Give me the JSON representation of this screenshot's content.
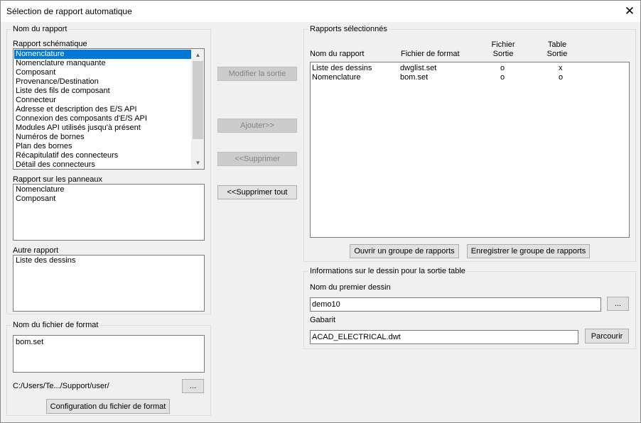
{
  "window": {
    "title": "Sélection de rapport automatique",
    "close_glyph": "✕"
  },
  "left": {
    "group_title": "Nom du rapport",
    "schematic": {
      "label": "Rapport schématique",
      "items": [
        "Nomenclature",
        "Nomenclature manquante",
        "Composant",
        "Provenance/Destination",
        "Liste des fils de composant",
        "Connecteur",
        "Adresse et description des E/S API",
        "Connexion des composants d'E/S API",
        "Modules API utilisés jusqu'à présent",
        "Numéros de bornes",
        "Plan des bornes",
        "Récapitulatif des connecteurs",
        "Détail des connecteurs"
      ],
      "selected": "Nomenclature",
      "scroll_up": "▲",
      "scroll_down": "▼"
    },
    "panel": {
      "label": "Rapport sur les panneaux",
      "items": [
        "Nomenclature",
        "Composant"
      ]
    },
    "other": {
      "label": "Autre rapport",
      "items": [
        "Liste des dessins"
      ]
    },
    "format_group": {
      "title": "Nom du fichier de format",
      "file": "bom.set",
      "path": "C:/Users/Te.../Support/user/",
      "browse_label": "...",
      "config_label": "Configuration du fichier de format"
    }
  },
  "middle": {
    "modify_label": "Modifier la sortie",
    "add_label": "Ajouter>>",
    "remove_label": "<<Supprimer",
    "remove_all_label": "<<Supprimer tout"
  },
  "right": {
    "group_title": "Rapports sélectionnés",
    "headers": {
      "name": "Nom du rapport",
      "format": "Fichier de format",
      "file_out_1": "Fichier",
      "file_out_2": "Sortie",
      "table_out_1": "Table",
      "table_out_2": "Sortie"
    },
    "rows": [
      {
        "name": "Liste des dessins",
        "format": "dwglist.set",
        "file": "o",
        "table": "x"
      },
      {
        "name": "Nomenclature",
        "format": "bom.set",
        "file": "o",
        "table": "o"
      }
    ],
    "open_group_label": "Ouvrir un groupe de rapports",
    "save_group_label": "Enregistrer le groupe de rapports",
    "drawing_info": {
      "title": "Informations sur le dessin pour la sortie table",
      "first_drawing_label": "Nom du premier dessin",
      "first_drawing_value": "demo10",
      "first_drawing_browse": "...",
      "template_label": "Gabarit",
      "template_value": "ACAD_ELECTRICAL.dwt",
      "template_browse": "Parcourir"
    }
  }
}
